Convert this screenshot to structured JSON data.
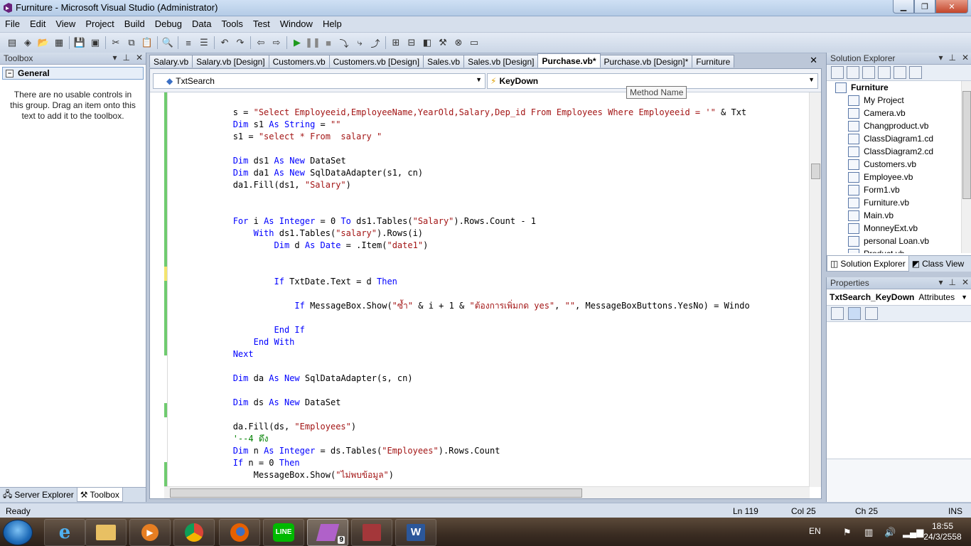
{
  "window": {
    "title": "Furniture - Microsoft Visual Studio (Administrator)"
  },
  "menu": [
    "File",
    "Edit",
    "View",
    "Project",
    "Build",
    "Debug",
    "Data",
    "Tools",
    "Test",
    "Window",
    "Help"
  ],
  "toolbox": {
    "title": "Toolbox",
    "group": "General",
    "message": "There are no usable controls in this group. Drag an item onto this text to add it to the toolbox.",
    "tabs": [
      "Server Explorer",
      "Toolbox"
    ]
  },
  "doc_tabs": [
    "Salary.vb",
    "Salary.vb [Design]",
    "Customers.vb",
    "Customers.vb [Design]",
    "Sales.vb",
    "Sales.vb [Design]",
    "Purchase.vb*",
    "Purchase.vb [Design]*",
    "Furniture"
  ],
  "editor": {
    "class_combo": "TxtSearch",
    "method_combo": "KeyDown",
    "tooltip": "Method Name",
    "lines": [
      [
        {
          "t": "            s = ",
          "c": ""
        },
        {
          "t": "\"Select Employeeid,EmployeeName,YearOld,Salary,Dep_id From Employees Where Employeeid = '\"",
          "c": "str"
        },
        {
          "t": " & Txt",
          "c": ""
        }
      ],
      [
        {
          "t": "            ",
          "c": ""
        },
        {
          "t": "Dim",
          "c": "kw"
        },
        {
          "t": " s1 ",
          "c": ""
        },
        {
          "t": "As String",
          "c": "kw"
        },
        {
          "t": " = ",
          "c": ""
        },
        {
          "t": "\"\"",
          "c": "str"
        }
      ],
      [
        {
          "t": "            s1 = ",
          "c": ""
        },
        {
          "t": "\"select * From  salary \"",
          "c": "str"
        }
      ],
      [
        {
          "t": "",
          "c": ""
        }
      ],
      [
        {
          "t": "            ",
          "c": ""
        },
        {
          "t": "Dim",
          "c": "kw"
        },
        {
          "t": " ds1 ",
          "c": ""
        },
        {
          "t": "As New",
          "c": "kw"
        },
        {
          "t": " DataSet",
          "c": ""
        }
      ],
      [
        {
          "t": "            ",
          "c": ""
        },
        {
          "t": "Dim",
          "c": "kw"
        },
        {
          "t": " da1 ",
          "c": ""
        },
        {
          "t": "As New",
          "c": "kw"
        },
        {
          "t": " SqlDataAdapter(s1, cn)",
          "c": ""
        }
      ],
      [
        {
          "t": "            da1.Fill(ds1, ",
          "c": ""
        },
        {
          "t": "\"Salary\"",
          "c": "str"
        },
        {
          "t": ")",
          "c": ""
        }
      ],
      [
        {
          "t": "",
          "c": ""
        }
      ],
      [
        {
          "t": "",
          "c": ""
        }
      ],
      [
        {
          "t": "            ",
          "c": ""
        },
        {
          "t": "For",
          "c": "kw"
        },
        {
          "t": " i ",
          "c": ""
        },
        {
          "t": "As Integer",
          "c": "kw"
        },
        {
          "t": " = 0 ",
          "c": ""
        },
        {
          "t": "To",
          "c": "kw"
        },
        {
          "t": " ds1.Tables(",
          "c": ""
        },
        {
          "t": "\"Salary\"",
          "c": "str"
        },
        {
          "t": ").Rows.Count - 1",
          "c": ""
        }
      ],
      [
        {
          "t": "                ",
          "c": ""
        },
        {
          "t": "With",
          "c": "kw"
        },
        {
          "t": " ds1.Tables(",
          "c": ""
        },
        {
          "t": "\"salary\"",
          "c": "str"
        },
        {
          "t": ").Rows(i)",
          "c": ""
        }
      ],
      [
        {
          "t": "                    ",
          "c": ""
        },
        {
          "t": "Dim",
          "c": "kw"
        },
        {
          "t": " d ",
          "c": ""
        },
        {
          "t": "As Date",
          "c": "kw"
        },
        {
          "t": " = .Item(",
          "c": ""
        },
        {
          "t": "\"date1\"",
          "c": "str"
        },
        {
          "t": ")",
          "c": ""
        }
      ],
      [
        {
          "t": "",
          "c": ""
        }
      ],
      [
        {
          "t": "",
          "c": ""
        }
      ],
      [
        {
          "t": "                    ",
          "c": ""
        },
        {
          "t": "If",
          "c": "kw"
        },
        {
          "t": " TxtDate.Text = d ",
          "c": ""
        },
        {
          "t": "Then",
          "c": "kw"
        }
      ],
      [
        {
          "t": "",
          "c": ""
        }
      ],
      [
        {
          "t": "                        ",
          "c": ""
        },
        {
          "t": "If",
          "c": "kw"
        },
        {
          "t": " MessageBox.Show(",
          "c": ""
        },
        {
          "t": "\"ซ้ำ\"",
          "c": "str"
        },
        {
          "t": " & i + 1 & ",
          "c": ""
        },
        {
          "t": "\"ต้องการเพิ่มกด yes\"",
          "c": "str"
        },
        {
          "t": ", ",
          "c": ""
        },
        {
          "t": "\"\"",
          "c": "str"
        },
        {
          "t": ", MessageBoxButtons.YesNo) = Windo",
          "c": ""
        }
      ],
      [
        {
          "t": "",
          "c": ""
        }
      ],
      [
        {
          "t": "                    ",
          "c": ""
        },
        {
          "t": "End If",
          "c": "kw"
        }
      ],
      [
        {
          "t": "                ",
          "c": ""
        },
        {
          "t": "End With",
          "c": "kw"
        }
      ],
      [
        {
          "t": "            ",
          "c": ""
        },
        {
          "t": "Next",
          "c": "kw"
        }
      ],
      [
        {
          "t": "",
          "c": ""
        }
      ],
      [
        {
          "t": "            ",
          "c": ""
        },
        {
          "t": "Dim",
          "c": "kw"
        },
        {
          "t": " da ",
          "c": ""
        },
        {
          "t": "As New",
          "c": "kw"
        },
        {
          "t": " SqlDataAdapter(s, cn)",
          "c": ""
        }
      ],
      [
        {
          "t": "",
          "c": ""
        }
      ],
      [
        {
          "t": "            ",
          "c": ""
        },
        {
          "t": "Dim",
          "c": "kw"
        },
        {
          "t": " ds ",
          "c": ""
        },
        {
          "t": "As New",
          "c": "kw"
        },
        {
          "t": " DataSet",
          "c": ""
        }
      ],
      [
        {
          "t": "",
          "c": ""
        }
      ],
      [
        {
          "t": "            da.Fill(ds, ",
          "c": ""
        },
        {
          "t": "\"Employees\"",
          "c": "str"
        },
        {
          "t": ")",
          "c": ""
        }
      ],
      [
        {
          "t": "            ",
          "c": ""
        },
        {
          "t": "'--4 ดึง",
          "c": "cm"
        }
      ],
      [
        {
          "t": "            ",
          "c": ""
        },
        {
          "t": "Dim",
          "c": "kw"
        },
        {
          "t": " n ",
          "c": ""
        },
        {
          "t": "As Integer",
          "c": "kw"
        },
        {
          "t": " = ds.Tables(",
          "c": ""
        },
        {
          "t": "\"Employees\"",
          "c": "str"
        },
        {
          "t": ").Rows.Count",
          "c": ""
        }
      ],
      [
        {
          "t": "            ",
          "c": ""
        },
        {
          "t": "If",
          "c": "kw"
        },
        {
          "t": " n = 0 ",
          "c": ""
        },
        {
          "t": "Then",
          "c": "kw"
        }
      ],
      [
        {
          "t": "                MessageBox.Show(",
          "c": ""
        },
        {
          "t": "\"ไม่พบข้อมูล\"",
          "c": "str"
        },
        {
          "t": ")",
          "c": ""
        }
      ]
    ],
    "colors": {
      "keyword": "#0000FF",
      "string": "#A31515",
      "comment": "#008000"
    }
  },
  "solution_explorer": {
    "title": "Solution Explorer",
    "root": "Furniture",
    "items": [
      "My Project",
      "Camera.vb",
      "Changproduct.vb",
      "ClassDiagram1.cd",
      "ClassDiagram2.cd",
      "Customers.vb",
      "Employee.vb",
      "Form1.vb",
      "Furniture.vb",
      "Main.vb",
      "MonneyExt.vb",
      "personal Loan.vb",
      "Product.vb"
    ],
    "tabs": [
      "Solution Explorer",
      "Class View"
    ]
  },
  "properties": {
    "title": "Properties",
    "object": "TxtSearch_KeyDown",
    "kind": "Attributes"
  },
  "status": {
    "ready": "Ready",
    "ln": "Ln 119",
    "col": "Col 25",
    "ch": "Ch 25",
    "mode": "INS"
  },
  "taskbar": {
    "apps": [
      "internet-explorer",
      "file-explorer",
      "media-player",
      "chrome",
      "firefox",
      "line",
      "visual-studio",
      "access",
      "word"
    ],
    "badge": "9",
    "lang": "EN",
    "time": "18:55",
    "date": "24/3/2558"
  }
}
